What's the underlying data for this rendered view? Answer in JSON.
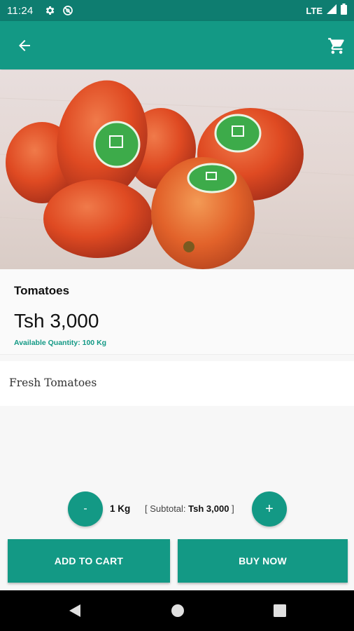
{
  "status_bar": {
    "time": "11:24",
    "network": "LTE",
    "icons": [
      "settings-icon",
      "do-not-disturb-icon",
      "signal-icon",
      "battery-icon"
    ]
  },
  "app_bar": {
    "back_icon": "arrow-left-icon",
    "cart_icon": "shopping-cart-icon",
    "color": "#139985"
  },
  "product": {
    "image": "tomatoes-photo",
    "name": "Tomatoes",
    "price": "Tsh 3,000",
    "available_quantity": "Available Quantity: 100 Kg",
    "description": "Fresh Tomatoes"
  },
  "quantity": {
    "minus_label": "-",
    "plus_label": "+",
    "value": "1 Kg",
    "subtotal_prefix": "[ Subtotal: ",
    "subtotal_value": "Tsh 3,000",
    "subtotal_suffix": " ]"
  },
  "actions": {
    "add_to_cart": "ADD TO CART",
    "buy_now": "BUY NOW"
  },
  "nav_bar": {
    "icons": [
      "back-triangle-icon",
      "home-circle-icon",
      "recents-square-icon"
    ]
  },
  "colors": {
    "accent": "#139985",
    "status_bar": "#0e7d70"
  }
}
